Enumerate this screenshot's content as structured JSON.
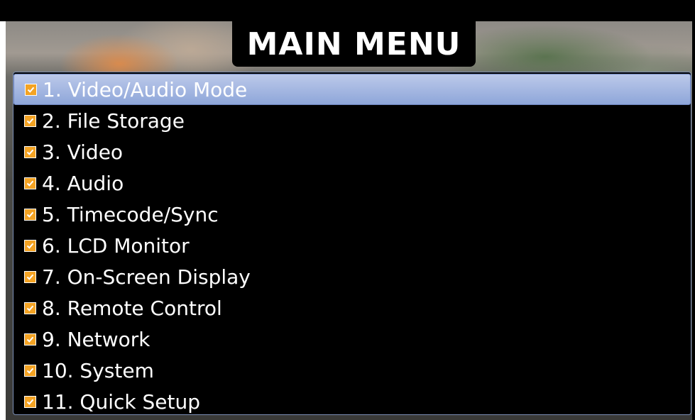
{
  "title": "MAIN MENU",
  "menu": {
    "selected_index": 0,
    "items": [
      {
        "label": "1. Video/Audio Mode",
        "checked": true
      },
      {
        "label": "2. File Storage",
        "checked": true
      },
      {
        "label": "3. Video",
        "checked": true
      },
      {
        "label": "4. Audio",
        "checked": true
      },
      {
        "label": "5. Timecode/Sync",
        "checked": true
      },
      {
        "label": "6. LCD Monitor",
        "checked": true
      },
      {
        "label": "7. On-Screen Display",
        "checked": true
      },
      {
        "label": "8. Remote Control",
        "checked": true
      },
      {
        "label": "9. Network",
        "checked": true
      },
      {
        "label": "10. System",
        "checked": true
      },
      {
        "label": "11. Quick Setup",
        "checked": true
      }
    ]
  },
  "colors": {
    "selection": "#9fb3e2",
    "check": "#f4a323",
    "panel_border": "#7c8fb5"
  },
  "icons": {
    "item_icon": "checkbox-checked-icon"
  }
}
